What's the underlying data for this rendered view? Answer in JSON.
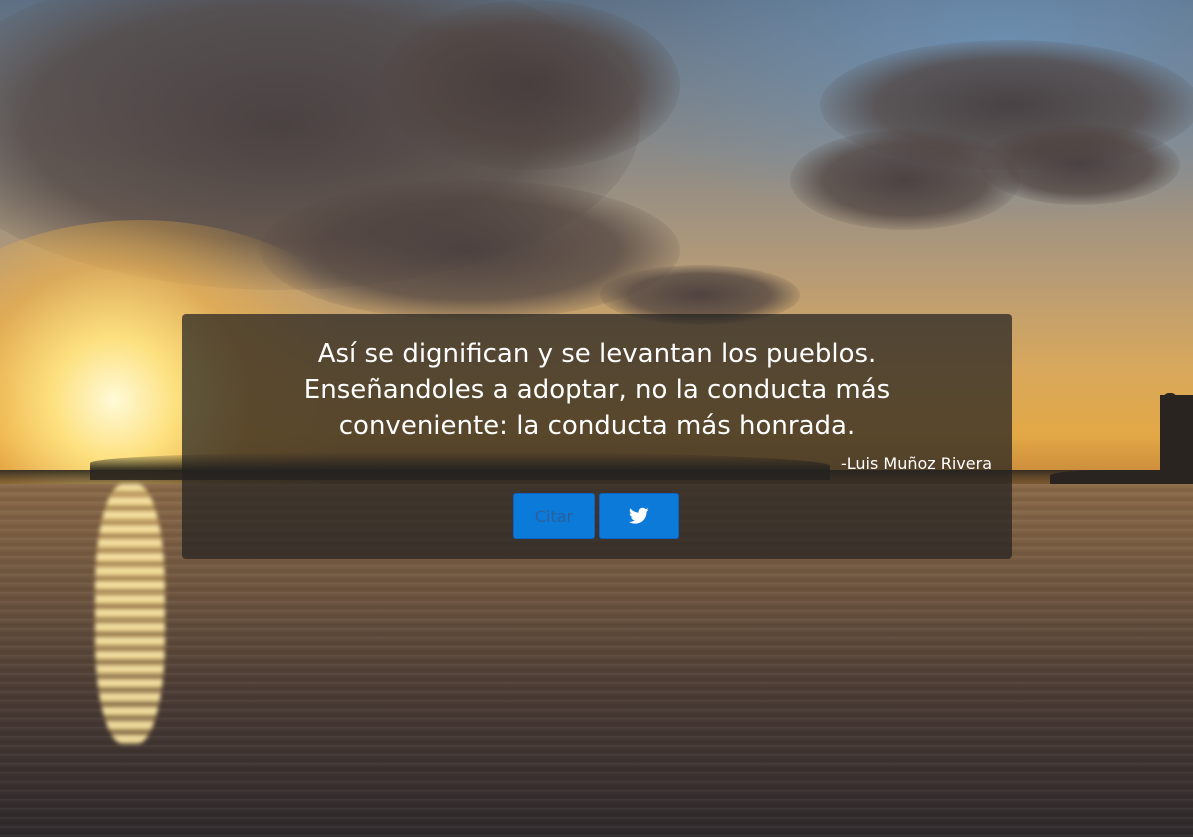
{
  "quote": {
    "text": "Así se dignifican y se levantan los pueblos.\nEnseñandoles a adoptar, no la conducta más\nconveniente: la conducta más honrada.",
    "author": "-Luis Muñoz Rivera"
  },
  "buttons": {
    "new_quote_label": "Citar",
    "tweet_icon": "twitter-icon"
  },
  "colors": {
    "button_bg": "#0b7ad8",
    "panel_bg": "rgba(35,33,33,0.72)",
    "text": "#ffffff"
  }
}
